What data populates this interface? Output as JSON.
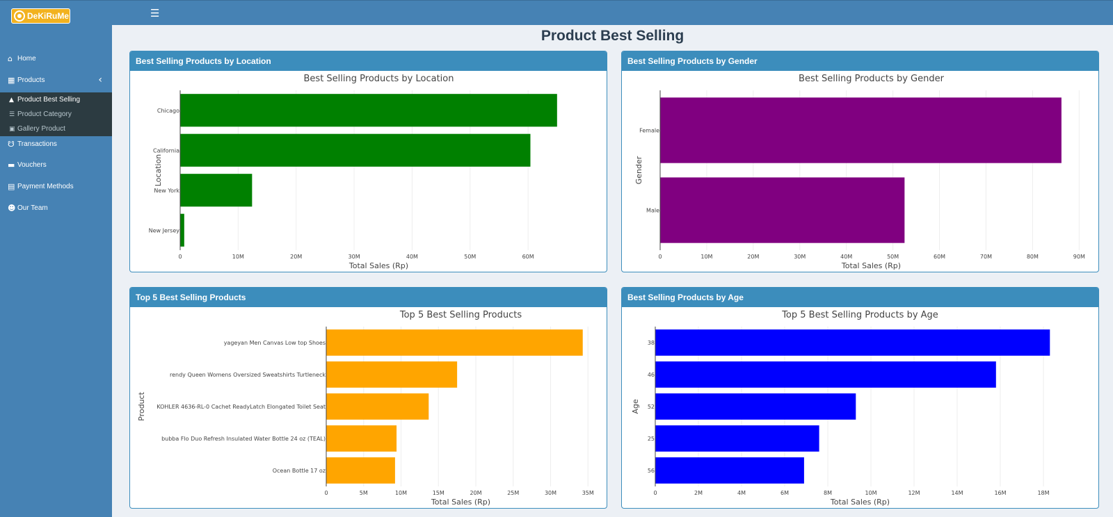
{
  "app": {
    "logo_text": "DeKiRuMe",
    "menu_icon": "hamburger-icon"
  },
  "sidebar": {
    "items": [
      {
        "label": "Home",
        "icon": "home-icon"
      },
      {
        "label": "Products",
        "icon": "products-icon"
      },
      {
        "label": "Transactions",
        "icon": "cart-icon"
      },
      {
        "label": "Vouchers",
        "icon": "ticket-icon"
      },
      {
        "label": "Payment Methods",
        "icon": "credit-card-icon"
      },
      {
        "label": "Our Team",
        "icon": "users-icon"
      }
    ],
    "submenu": [
      {
        "label": "Product Best Selling",
        "icon": "thumbs-up-icon",
        "active": true
      },
      {
        "label": "Product Category",
        "icon": "list-icon",
        "active": false
      },
      {
        "label": "Gallery Product",
        "icon": "image-icon",
        "active": false
      }
    ]
  },
  "page": {
    "title": "Product Best Selling"
  },
  "panels": [
    {
      "header": "Best Selling Products by Location"
    },
    {
      "header": "Best Selling Products by Gender"
    },
    {
      "header": "Top 5 Best Selling Products"
    },
    {
      "header": "Best Selling Products by Age"
    }
  ],
  "chart_data": [
    {
      "type": "bar",
      "orientation": "horizontal",
      "title": "Best Selling Products by Location",
      "xlabel": "Total Sales (Rp)",
      "ylabel": "Location",
      "categories": [
        "Chicago",
        "California",
        "New York",
        "New Jersey"
      ],
      "values": [
        65000000,
        60400000,
        12400000,
        700000
      ],
      "xlim": [
        0,
        68500000
      ],
      "xticks": [
        0,
        10000000,
        20000000,
        30000000,
        40000000,
        50000000,
        60000000
      ],
      "xtick_labels": [
        "0",
        "10M",
        "20M",
        "30M",
        "40M",
        "50M",
        "60M"
      ],
      "color": "#008000",
      "grid": true
    },
    {
      "type": "bar",
      "orientation": "horizontal",
      "title": "Best Selling Products by Gender",
      "xlabel": "Total Sales (Rp)",
      "ylabel": "Gender",
      "categories": [
        "Female",
        "Male"
      ],
      "values": [
        86200000,
        52500000
      ],
      "xlim": [
        0,
        90700000
      ],
      "xticks": [
        0,
        10000000,
        20000000,
        30000000,
        40000000,
        50000000,
        60000000,
        70000000,
        80000000,
        90000000
      ],
      "xtick_labels": [
        "0",
        "10M",
        "20M",
        "30M",
        "40M",
        "50M",
        "60M",
        "70M",
        "80M",
        "90M"
      ],
      "color": "#800080",
      "grid": true
    },
    {
      "type": "bar",
      "orientation": "horizontal",
      "title": "Top 5 Best Selling Products",
      "xlabel": "Total Sales (Rp)",
      "ylabel": "Product",
      "categories": [
        "yageyan Men Canvas Low top Shoes",
        "rendy Queen Womens Oversized Sweatshirts Turtleneck",
        "KOHLER 4636-RL-0 Cachet ReadyLatch Elongated Toilet Seat",
        "bubba Flo Duo Refresh Insulated Water Bottle 24 oz (TEAL)",
        "Ocean Bottle 17 oz"
      ],
      "values": [
        34300000,
        17500000,
        13700000,
        9400000,
        9200000
      ],
      "xlim": [
        0,
        36000000
      ],
      "xticks": [
        0,
        5000000,
        10000000,
        15000000,
        20000000,
        25000000,
        30000000,
        35000000
      ],
      "xtick_labels": [
        "0",
        "5M",
        "10M",
        "15M",
        "20M",
        "25M",
        "30M",
        "35M"
      ],
      "color": "#ffa500",
      "grid": true
    },
    {
      "type": "bar",
      "orientation": "horizontal",
      "title": "Top 5 Best Selling Products by Age",
      "xlabel": "Total Sales (Rp)",
      "ylabel": "Age",
      "categories": [
        "38",
        "46",
        "52",
        "25",
        "56"
      ],
      "values": [
        18300000,
        15800000,
        9300000,
        7600000,
        6900000
      ],
      "xlim": [
        0,
        19000000
      ],
      "xticks": [
        0,
        2000000,
        4000000,
        6000000,
        8000000,
        10000000,
        12000000,
        14000000,
        16000000,
        18000000
      ],
      "xtick_labels": [
        "0",
        "2M",
        "4M",
        "6M",
        "8M",
        "10M",
        "12M",
        "14M",
        "16M",
        "18M"
      ],
      "color": "#0000ff",
      "grid": true
    }
  ]
}
